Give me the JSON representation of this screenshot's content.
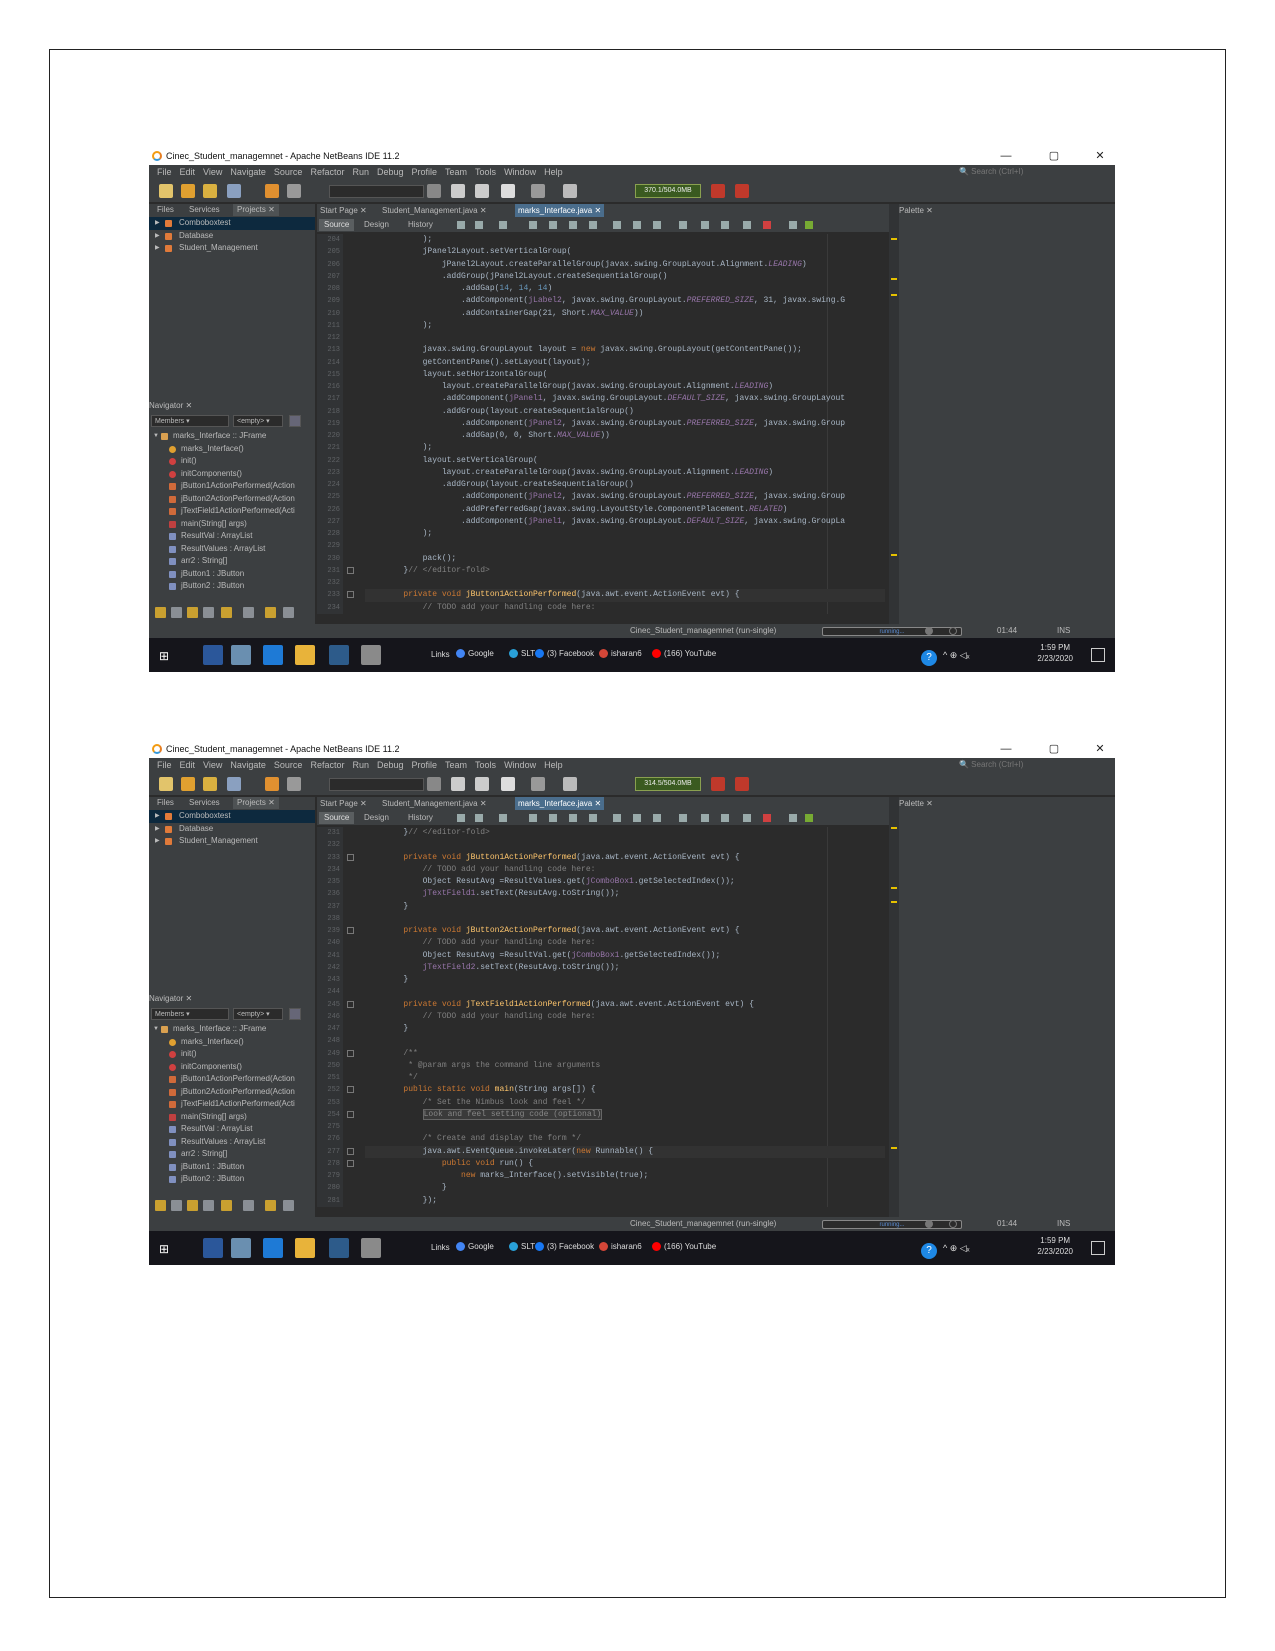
{
  "window": {
    "title": "Cinec_Student_managemnet - Apache NetBeans IDE 11.2",
    "controls": {
      "minimize": "—",
      "maximize": "▢",
      "close": "✕"
    }
  },
  "menu": [
    "File",
    "Edit",
    "View",
    "Navigate",
    "Source",
    "Refactor",
    "Run",
    "Debug",
    "Profile",
    "Team",
    "Tools",
    "Window",
    "Help"
  ],
  "search_placeholder": "Search (Ctrl+I)",
  "memory_labels": [
    "370.1/504.0MB",
    "314.5/504.0MB"
  ],
  "left_tabs": [
    "Files",
    "Services",
    "Projects"
  ],
  "projects": [
    "Comboboxtest",
    "Database",
    "Student_Management"
  ],
  "navigator": {
    "title": "Navigator",
    "members": "Members",
    "empty": "<empty>",
    "items": [
      "marks_Interface :: JFrame",
      "marks_Interface()",
      "init()",
      "initComponents()",
      "jButton1ActionPerformed(Action",
      "jButton2ActionPerformed(Action",
      "jTextField1ActionPerformed(Acti",
      "main(String[] args)",
      "ResultVal : ArrayList",
      "ResultValues : ArrayList",
      "arr2 : String[]",
      "jButton1 : JButton",
      "jButton2 : JButton"
    ]
  },
  "editor_tabs": [
    "Start Page",
    "Student_Management.java",
    "marks_Interface.java"
  ],
  "editor_views": [
    "Source",
    "Design",
    "History"
  ],
  "palette_title": "Palette",
  "status": {
    "task": "Cinec_Student_managemnet (run-single)",
    "progress": "running...",
    "position": "01:44",
    "mode": "INS"
  },
  "taskbar": {
    "links": "Links",
    "bookmarks": [
      "Google",
      "SLT",
      "(3) Facebook",
      "isharan6",
      "(166) YouTube"
    ],
    "time": "1:59 PM",
    "date": "2/23/2020"
  },
  "screens": [
    {
      "lines": [
        "204",
        "205",
        "206",
        "207",
        "208",
        "209",
        "210",
        "211",
        "212",
        "213",
        "214",
        "215",
        "216",
        "217",
        "218",
        "219",
        "220",
        "221",
        "222",
        "223",
        "224",
        "225",
        "226",
        "227",
        "228",
        "229",
        "230",
        "231",
        "232",
        "233",
        "234"
      ],
      "code": [
        "            );",
        "            jPanel2Layout.setVerticalGroup(",
        "                jPanel2Layout.createParallelGroup(javax.swing.GroupLayout.Alignment.LEADING)",
        "                .addGroup(jPanel2Layout.createSequentialGroup()",
        "                    .addGap(14, 14, 14)",
        "                    .addComponent(jLabel2, javax.swing.GroupLayout.PREFERRED_SIZE, 31, javax.swing.G",
        "                    .addContainerGap(21, Short.MAX_VALUE))",
        "            );",
        "",
        "            javax.swing.GroupLayout layout = new javax.swing.GroupLayout(getContentPane());",
        "            getContentPane().setLayout(layout);",
        "            layout.setHorizontalGroup(",
        "                layout.createParallelGroup(javax.swing.GroupLayout.Alignment.LEADING)",
        "                .addComponent(jPanel1, javax.swing.GroupLayout.DEFAULT_SIZE, javax.swing.GroupLayout",
        "                .addGroup(layout.createSequentialGroup()",
        "                    .addComponent(jPanel2, javax.swing.GroupLayout.PREFERRED_SIZE, javax.swing.Group",
        "                    .addGap(0, 0, Short.MAX_VALUE))",
        "            );",
        "            layout.setVerticalGroup(",
        "                layout.createParallelGroup(javax.swing.GroupLayout.Alignment.LEADING)",
        "                .addGroup(layout.createSequentialGroup()",
        "                    .addComponent(jPanel2, javax.swing.GroupLayout.PREFERRED_SIZE, javax.swing.Group",
        "                    .addPreferredGap(javax.swing.LayoutStyle.ComponentPlacement.RELATED)",
        "                    .addComponent(jPanel1, javax.swing.GroupLayout.DEFAULT_SIZE, javax.swing.GroupLa",
        "            );",
        "",
        "            pack();",
        "        }// </editor-fold>",
        "",
        "        private void jButton1ActionPerformed(java.awt.event.ActionEvent evt) {",
        "            // TODO add your handling code here:"
      ]
    },
    {
      "lines": [
        "231",
        "232",
        "233",
        "234",
        "235",
        "236",
        "237",
        "238",
        "239",
        "240",
        "241",
        "242",
        "243",
        "244",
        "245",
        "246",
        "247",
        "248",
        "249",
        "250",
        "251",
        "252",
        "253",
        "254",
        "275",
        "276",
        "277",
        "278",
        "279",
        "280",
        "281"
      ],
      "code": [
        "        }// </editor-fold>",
        "",
        "        private void jButton1ActionPerformed(java.awt.event.ActionEvent evt) {",
        "            // TODO add your handling code here:",
        "            Object ResutAvg =ResultValues.get(jComboBox1.getSelectedIndex());",
        "            jTextField1.setText(ResutAvg.toString());",
        "        }",
        "",
        "        private void jButton2ActionPerformed(java.awt.event.ActionEvent evt) {",
        "            // TODO add your handling code here:",
        "            Object ResutAvg =ResultVal.get(jComboBox1.getSelectedIndex());",
        "            jTextField2.setText(ResutAvg.toString());",
        "        }",
        "",
        "        private void jTextField1ActionPerformed(java.awt.event.ActionEvent evt) {",
        "            // TODO add your handling code here:",
        "        }",
        "",
        "        /**",
        "         * @param args the command line arguments",
        "         */",
        "        public static void main(String args[]) {",
        "            /* Set the Nimbus look and feel */",
        "            Look and feel setting code (optional)",
        "",
        "            /* Create and display the form */",
        "            java.awt.EventQueue.invokeLater(new Runnable() {",
        "                public void run() {",
        "                    new marks_Interface().setVisible(true);",
        "                }",
        "            });"
      ]
    }
  ]
}
